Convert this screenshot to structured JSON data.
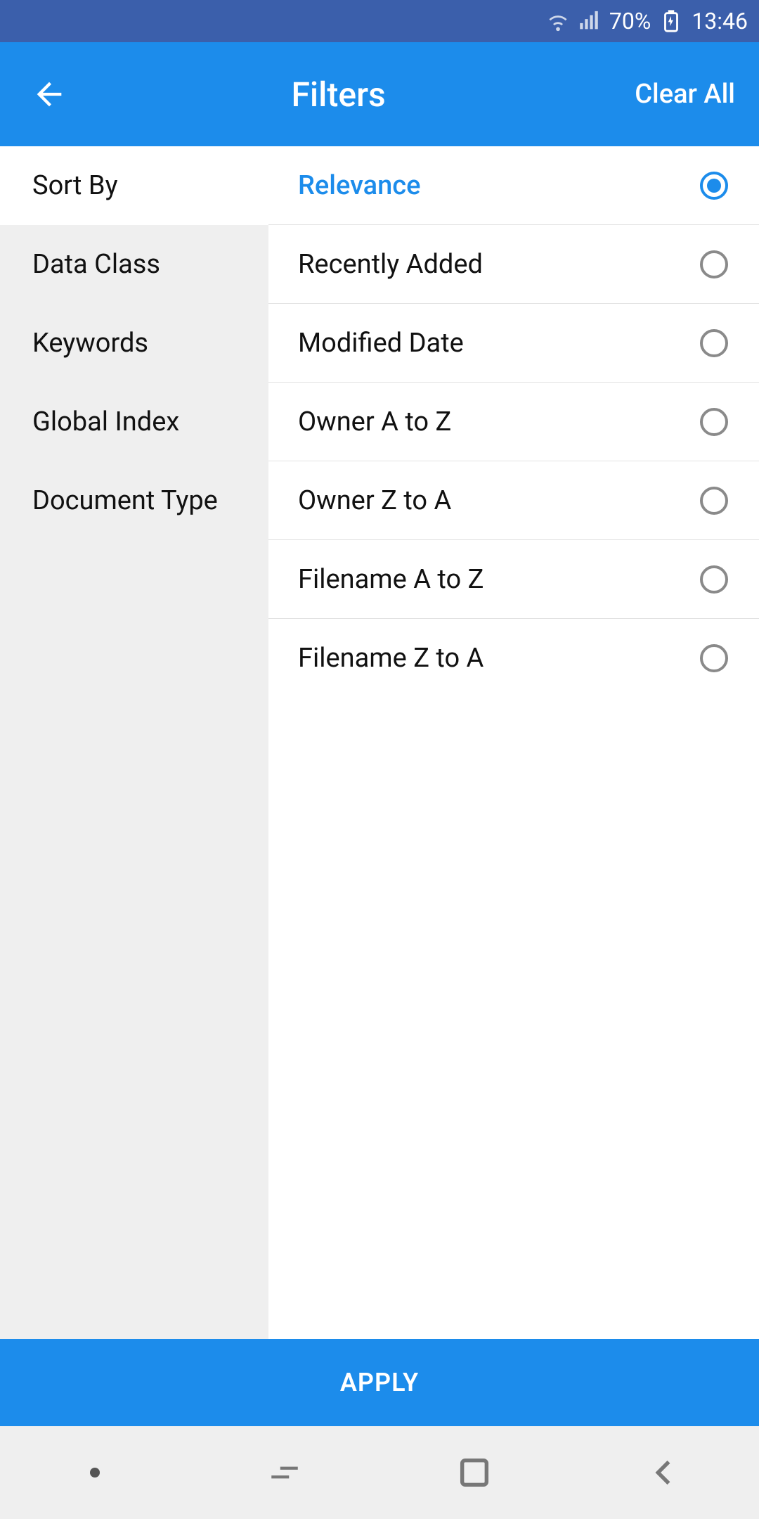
{
  "status": {
    "battery": "70%",
    "time": "13:46"
  },
  "toolbar": {
    "title": "Filters",
    "clear": "Clear All"
  },
  "sidebar": {
    "items": [
      {
        "label": "Sort By",
        "active": true
      },
      {
        "label": "Data Class",
        "active": false
      },
      {
        "label": "Keywords",
        "active": false
      },
      {
        "label": "Global Index",
        "active": false
      },
      {
        "label": "Document Type",
        "active": false
      }
    ]
  },
  "options": [
    {
      "label": "Relevance",
      "selected": true
    },
    {
      "label": "Recently Added",
      "selected": false
    },
    {
      "label": "Modified Date",
      "selected": false
    },
    {
      "label": "Owner A to Z",
      "selected": false
    },
    {
      "label": "Owner Z to A",
      "selected": false
    },
    {
      "label": "Filename A to Z",
      "selected": false
    },
    {
      "label": "Filename Z to A",
      "selected": false
    }
  ],
  "apply": "APPLY",
  "colors": {
    "accent": "#1c8ceb",
    "statusbar": "#3b5fab"
  }
}
